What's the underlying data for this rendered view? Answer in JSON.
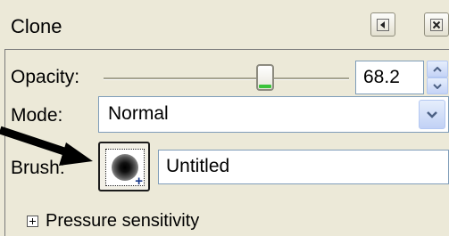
{
  "dialog": {
    "title": "Clone",
    "menu_icon": "triangle-left-icon",
    "close_icon": "close-x-icon"
  },
  "opacity": {
    "label": "Opacity:",
    "value": "68.2",
    "slider_fraction": 0.682
  },
  "mode": {
    "label": "Mode:",
    "selected": "Normal"
  },
  "brush": {
    "label": "Brush:",
    "name": "Untitled"
  },
  "pressure": {
    "label": "Pressure sensitivity"
  },
  "annotation": {
    "arrow_color": "#000000"
  }
}
